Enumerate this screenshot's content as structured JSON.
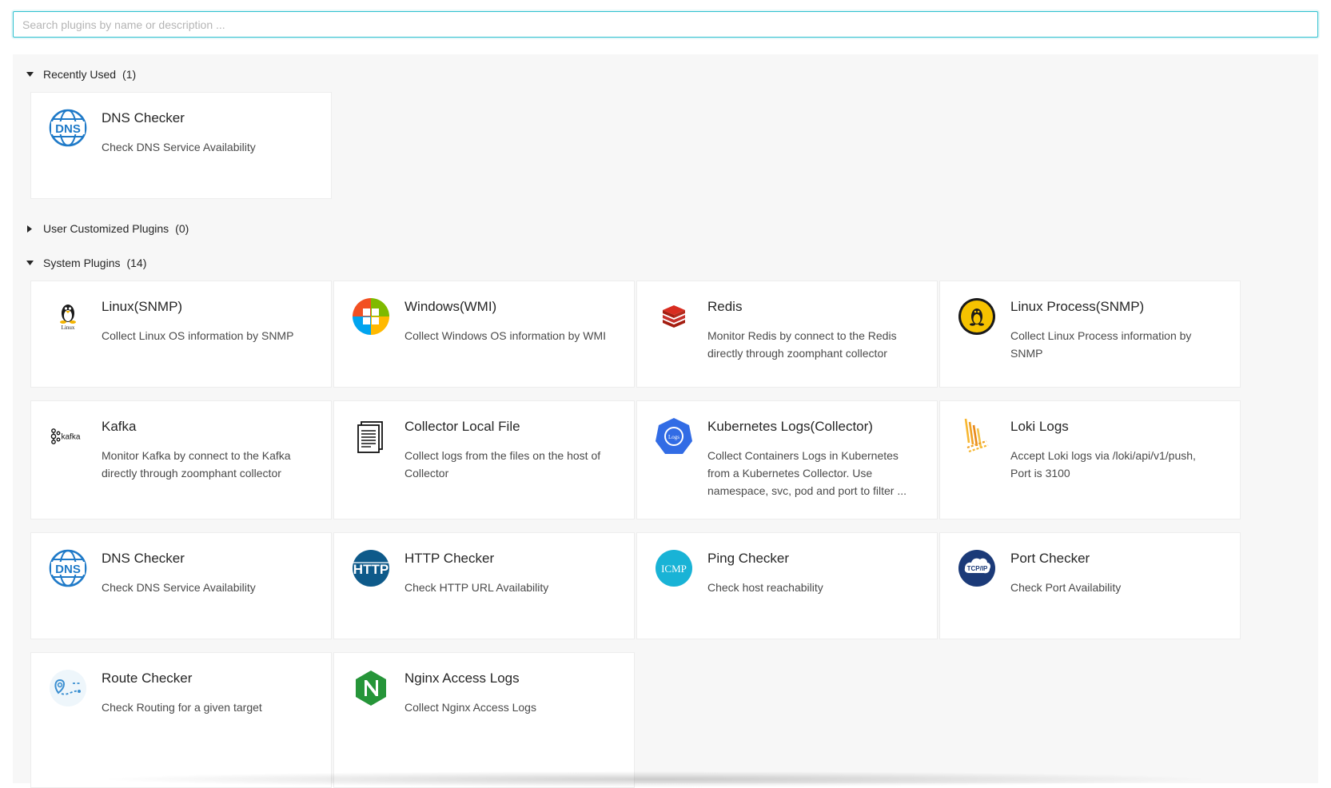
{
  "search": {
    "placeholder": "Search plugins by name or description ..."
  },
  "sections": {
    "recent": {
      "label": "Recently Used",
      "count": "(1)"
    },
    "custom": {
      "label": "User Customized Plugins",
      "count": "(0)"
    },
    "system": {
      "label": "System Plugins",
      "count": "(14)"
    }
  },
  "recent_plugins": [
    {
      "title": "DNS Checker",
      "desc": "Check DNS Service Availability",
      "icon": "dns-icon"
    }
  ],
  "system_plugins": [
    {
      "title": "Linux(SNMP)",
      "desc": "Collect Linux OS information by SNMP",
      "icon": "linux-icon",
      "icon_label": "Linux"
    },
    {
      "title": "Windows(WMI)",
      "desc": "Collect Windows OS information by WMI",
      "icon": "windows-icon"
    },
    {
      "title": "Redis",
      "desc": "Monitor Redis by connect to the Redis directly through zoomphant collector",
      "icon": "redis-icon"
    },
    {
      "title": "Linux Process(SNMP)",
      "desc": "Collect Linux Process information by SNMP",
      "icon": "linux-process-icon"
    },
    {
      "title": "Kafka",
      "desc": "Monitor Kafka by connect to the Kafka directly through zoomphant collector",
      "icon": "kafka-icon",
      "icon_label": "kafka"
    },
    {
      "title": "Collector Local File",
      "desc": "Collect logs from the files on the host of Collector",
      "icon": "file-icon"
    },
    {
      "title": "Kubernetes Logs(Collector)",
      "desc": "Collect Containers Logs in Kubernetes from a Kubernetes Collector. Use namespace, svc, pod and port to filter ...",
      "icon": "kubernetes-logs-icon",
      "icon_label": "Logs"
    },
    {
      "title": "Loki Logs",
      "desc": "Accept Loki logs via /loki/api/v1/push, Port is 3100",
      "icon": "loki-icon"
    },
    {
      "title": "DNS Checker",
      "desc": "Check DNS Service Availability",
      "icon": "dns-icon"
    },
    {
      "title": "HTTP Checker",
      "desc": "Check HTTP URL Availability",
      "icon": "http-icon",
      "icon_label": "HTTP"
    },
    {
      "title": "Ping Checker",
      "desc": "Check host reachability",
      "icon": "icmp-icon",
      "icon_label": "ICMP"
    },
    {
      "title": "Port Checker",
      "desc": "Check Port Availability",
      "icon": "tcpip-icon",
      "icon_label": "TCP/IP"
    },
    {
      "title": "Route Checker",
      "desc": "Check Routing for a given target",
      "icon": "route-icon"
    },
    {
      "title": "Nginx Access Logs",
      "desc": "Collect Nginx Access Logs",
      "icon": "nginx-icon"
    }
  ],
  "dns_icon_label": "DNS",
  "colors": {
    "accent": "#2fc1cf",
    "dns_blue": "#1f7ac8",
    "redis_red": "#c6302b",
    "http_blue": "#0e5a8a",
    "icmp_cyan": "#19b3d6",
    "tcpip_navy": "#1b3a78",
    "kube_blue": "#326ce5",
    "nginx_green": "#269539",
    "loki_orange": "#f0a022"
  }
}
